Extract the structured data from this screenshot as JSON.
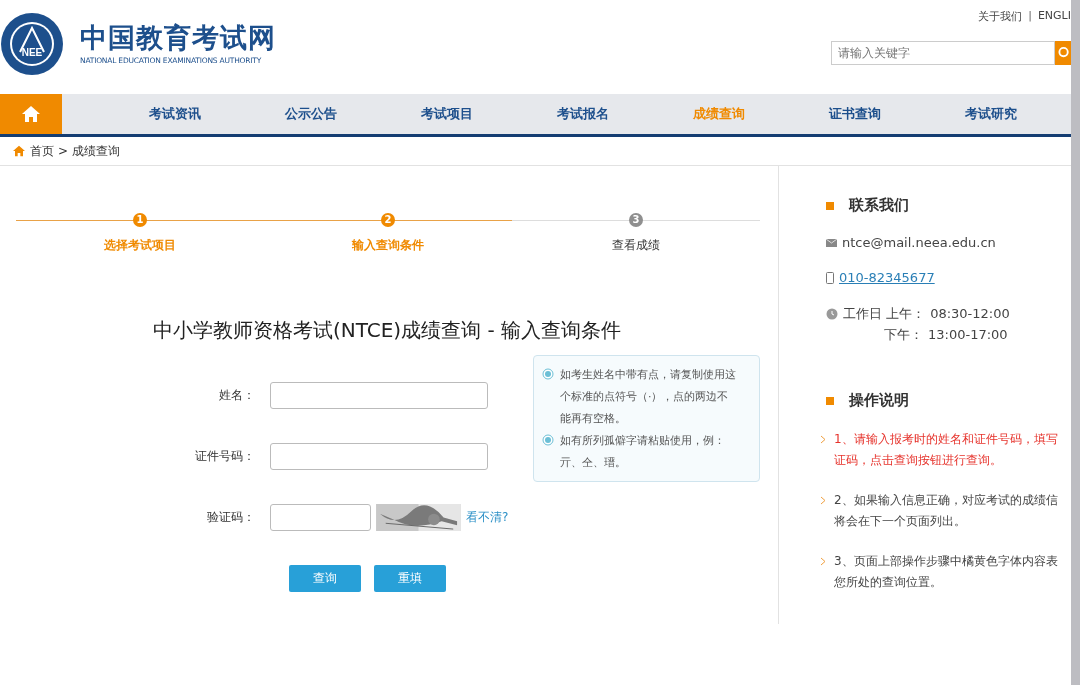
{
  "header": {
    "logo_text": "NEE",
    "site_title": "中国教育考试网",
    "site_subtitle": "NATIONAL EDUCATION EXAMINATIONS AUTHORITY",
    "top_links": [
      "关于我们",
      "ENGLI"
    ],
    "link_separator": "|",
    "search": {
      "placeholder": "请输入关键字"
    }
  },
  "nav": [
    {
      "label": "考试资讯",
      "selected": false
    },
    {
      "label": "公示公告",
      "selected": false
    },
    {
      "label": "考试项目",
      "selected": false
    },
    {
      "label": "考试报名",
      "selected": false
    },
    {
      "label": "成绩查询",
      "selected": true
    },
    {
      "label": "证书查询",
      "selected": false
    },
    {
      "label": "考试研究",
      "selected": false
    }
  ],
  "breadcrumb": {
    "items": [
      "首页",
      "成绩查询"
    ],
    "separator": ">"
  },
  "steps": [
    {
      "number": "1",
      "label": "选择考试项目",
      "reached": true
    },
    {
      "number": "2",
      "label": "输入查询条件",
      "reached": true
    },
    {
      "number": "3",
      "label": "查看成绩",
      "reached": false
    }
  ],
  "form": {
    "title": "中小学教师资格考试(NTCE)成绩查询 - 输入查询条件",
    "fields": [
      {
        "label": "姓名：",
        "kind": "text"
      },
      {
        "label": "证件号码：",
        "kind": "text"
      },
      {
        "label": "验证码：",
        "kind": "captcha",
        "refresh_link": "看不清?"
      }
    ],
    "tips": [
      {
        "lines": [
          "如考生姓名中带有点，请复制使用这",
          "个标准的点符号（·），点的两边不",
          "能再有空格。"
        ]
      },
      {
        "lines": [
          "如有所列孤僻字请粘贴使用，例：",
          "亓、仝、瑨。"
        ]
      }
    ],
    "buttons": [
      "查询",
      "重填"
    ]
  },
  "sidebar": {
    "contact": {
      "title": "联系我们",
      "email": "ntce@mail.neea.edu.cn",
      "phone": "010-82345677",
      "hours": [
        {
          "period": "工作日 上午：",
          "time": "08:30-12:00"
        },
        {
          "period": "下午：",
          "time": "13:00-17:00"
        }
      ]
    },
    "instructions": {
      "title": "操作说明",
      "items": [
        {
          "lines": [
            "1、请输入报考时的姓名和证件号码，填写",
            "证码，点击查询按钮进行查询。"
          ],
          "highlight": true
        },
        {
          "lines": [
            "2、如果输入信息正确，对应考试的成绩信",
            "将会在下一个页面列出。"
          ],
          "highlight": false
        },
        {
          "lines": [
            "3、页面上部操作步骤中橘黄色字体内容表",
            "您所处的查询位置。"
          ],
          "highlight": false
        }
      ]
    }
  }
}
